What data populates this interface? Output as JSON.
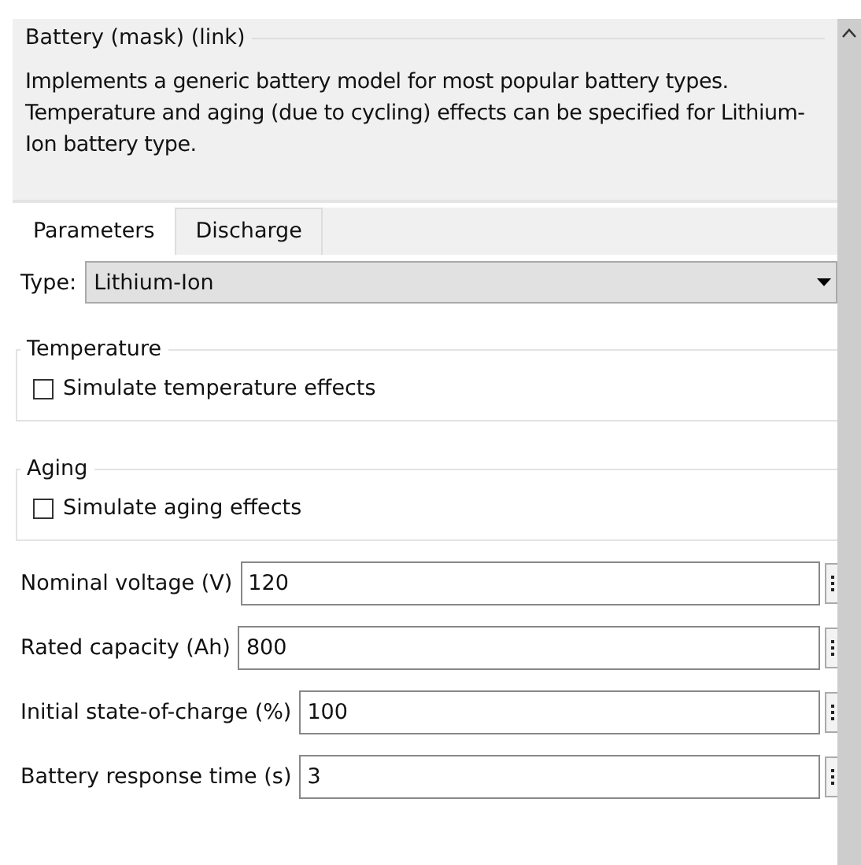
{
  "block": {
    "title": "Battery (mask) (link)",
    "description": "Implements a generic battery model for most popular battery types. Temperature and aging (due to cycling) effects can be specified for Lithium-Ion battery type."
  },
  "tabs": [
    {
      "label": "Parameters",
      "selected": true
    },
    {
      "label": "Discharge",
      "selected": false
    }
  ],
  "type": {
    "label": "Type:",
    "value": "Lithium-Ion"
  },
  "groups": [
    {
      "title": "Temperature",
      "option": {
        "label": "Simulate temperature effects",
        "checked": false
      }
    },
    {
      "title": "Aging",
      "option": {
        "label": "Simulate aging effects",
        "checked": false
      }
    }
  ],
  "fields": [
    {
      "label": "Nominal voltage (V)",
      "value": "120"
    },
    {
      "label": "Rated capacity (Ah)",
      "value": "800"
    },
    {
      "label": "Initial state-of-charge (%)",
      "value": "100"
    },
    {
      "label": "Battery response time (s)",
      "value": "3"
    }
  ]
}
